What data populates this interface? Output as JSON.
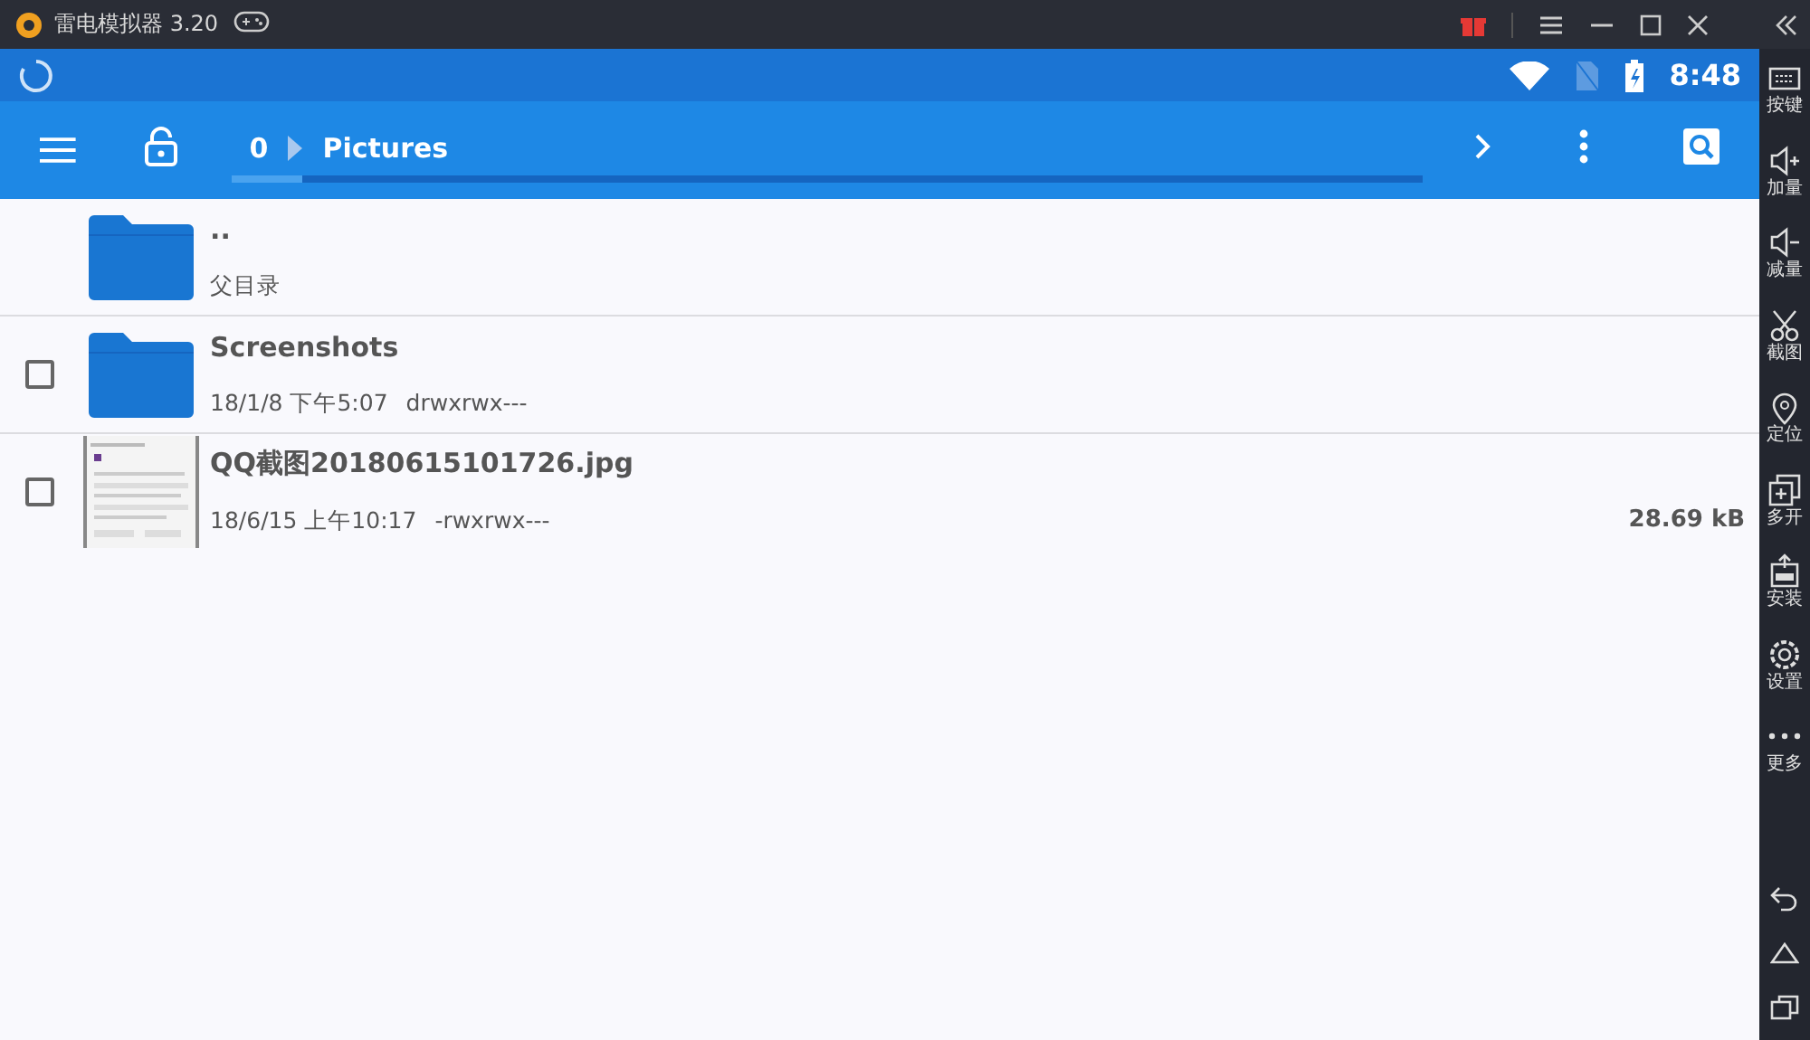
{
  "window": {
    "title": "雷电模拟器 3.20"
  },
  "status_bar": {
    "time": "8:48"
  },
  "toolbar": {
    "path": [
      {
        "label": "0"
      },
      {
        "label": "Pictures"
      }
    ],
    "scan": {
      "level": 0.06
    }
  },
  "files": [
    {
      "kind": "parent",
      "name": "..",
      "detail": "父目录"
    },
    {
      "kind": "folder",
      "name": "Screenshots",
      "detail": "18/1/8 下午5:07",
      "perms": "drwxrwx---",
      "checked": false
    },
    {
      "kind": "image",
      "name": "QQ截图20180615101726.jpg",
      "detail": "18/6/15 上午10:17",
      "perms": "-rwxrwx---",
      "size": "28.69 kB",
      "checked": false
    }
  ],
  "sidebar": {
    "items": [
      {
        "kind": "keyboard",
        "label": "按键"
      },
      {
        "kind": "volup",
        "label": "加量"
      },
      {
        "kind": "voldown",
        "label": "减量"
      },
      {
        "kind": "scissors",
        "label": "截图"
      },
      {
        "kind": "pin",
        "label": "定位"
      },
      {
        "kind": "multi",
        "label": "多开"
      },
      {
        "kind": "apk",
        "label": "安装"
      },
      {
        "kind": "gear",
        "label": "设置"
      },
      {
        "kind": "dots",
        "label": "更多"
      }
    ]
  }
}
